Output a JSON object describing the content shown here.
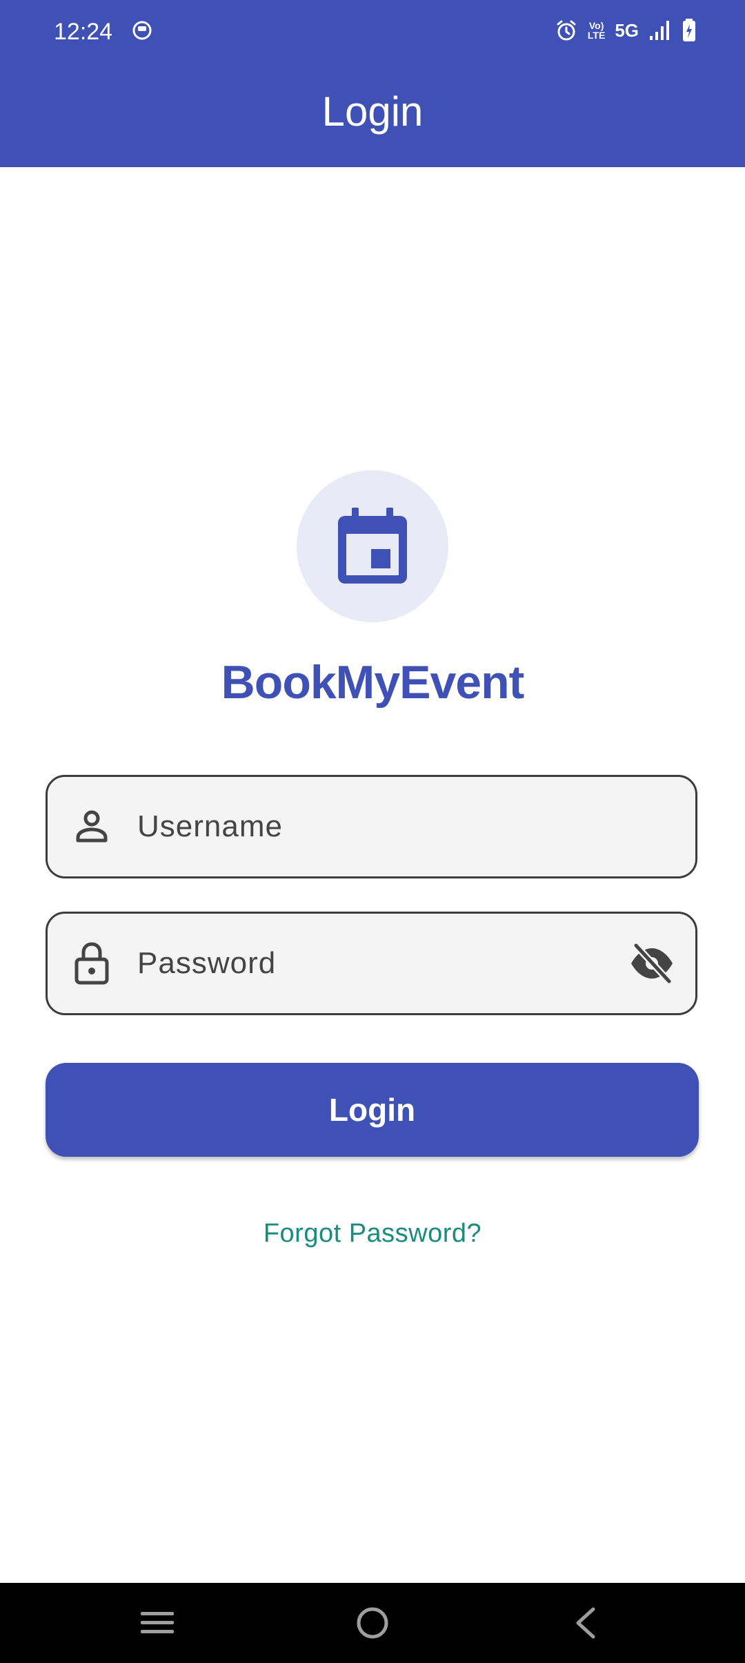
{
  "status_bar": {
    "time": "12:24",
    "network_lte_top": "Vo)",
    "network_lte_bottom": "LTE",
    "network_type": "5G"
  },
  "app_bar": {
    "title": "Login"
  },
  "brand": {
    "name": "BookMyEvent",
    "logo_icon": "calendar-icon"
  },
  "form": {
    "username": {
      "placeholder": "Username",
      "value": "",
      "icon": "person-icon"
    },
    "password": {
      "placeholder": "Password",
      "value": "",
      "icon": "lock-icon",
      "toggle_icon": "visibility-off-icon"
    },
    "login_label": "Login",
    "forgot_label": "Forgot Password?"
  },
  "colors": {
    "primary": "#3f51b5",
    "logo_bg": "#e8eaf6",
    "link": "#1a8c7c",
    "field_bg": "#f4f4f4"
  }
}
